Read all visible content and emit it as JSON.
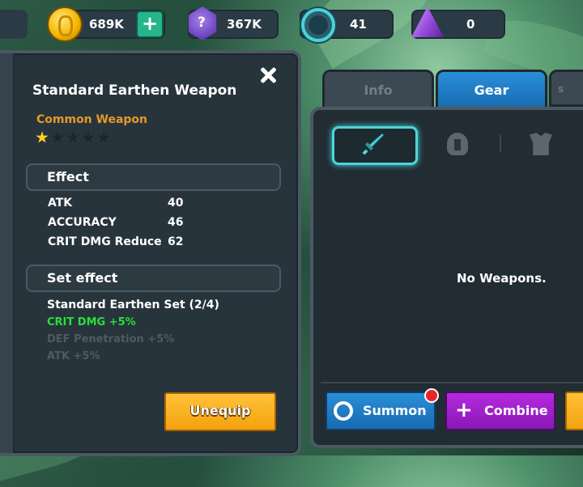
{
  "currency": {
    "gold": "689K",
    "gems": "367K",
    "rings": "41",
    "crystals": "0"
  },
  "item": {
    "title": "Standard Earthen Weapon",
    "rarity": "Common Weapon",
    "stars_filled": 1,
    "stars_total": 5,
    "effect_header": "Effect",
    "stats": [
      {
        "name": "ATK",
        "value": "40"
      },
      {
        "name": "ACCURACY",
        "value": "46"
      },
      {
        "name": "CRIT DMG Reduce",
        "value": "62"
      }
    ],
    "set_header": "Set effect",
    "set_name": "Standard Earthen Set (2/4)",
    "set_bonuses": [
      {
        "text": "CRIT DMG +5%",
        "active": true,
        "color": "#27e03b"
      },
      {
        "text": "DEF Penetration +5%",
        "active": false,
        "color": "#4f5a61"
      },
      {
        "text": "ATK +5%",
        "active": false,
        "color": "#4f5a61"
      }
    ],
    "unequip_label": "Unequip"
  },
  "tabs": {
    "info": "Info",
    "gear": "Gear",
    "more": "S"
  },
  "inventory": {
    "empty_text": "No Weapons.",
    "summon_label": "Summon",
    "combine_label": "Combine"
  },
  "colors": {
    "accent_cyan": "#4bd6da",
    "gear_tab_blue": "#2a8ed8",
    "unequip_orange": "#f3a20e",
    "combine_purple": "#b52ae0",
    "rarity_orange": "#e59a2a"
  }
}
